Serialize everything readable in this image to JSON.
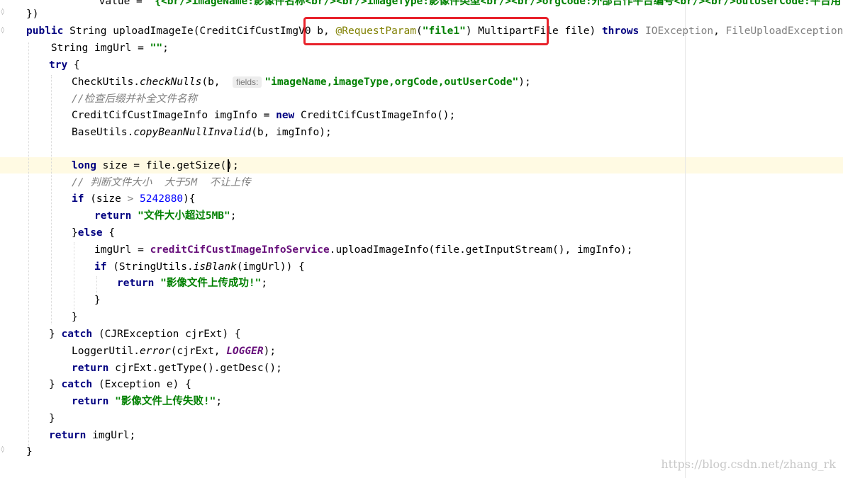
{
  "editor": {
    "top_line": {
      "prefix": "                value = ",
      "text": "\"{<br/>imageName:影像件名称<br/><br/>imageType:影像件类型<br/><br/>orgCode:外部合作平台编号<br/><br/>outUserCode:平台用"
    },
    "lines": {
      "l01": "})",
      "l02_kw1": "public",
      "l02_a": " String uploadImageIe(CreditCifCustImgV0 b, ",
      "l02_ann": "@RequestParam",
      "l02_b": "(",
      "l02_str": "\"file1\"",
      "l02_c": ") MultipartFile file) ",
      "l02_kw2": "throws",
      "l02_ex1": " IOException",
      "l02_d": ", ",
      "l02_ex2": "FileUploadException",
      "l02_e": " {",
      "l03_a": "    String imgUrl = ",
      "l03_str": "\"\"",
      "l03_b": ";",
      "l04_kw": "try",
      "l04_b": " {",
      "l05_a": "CheckUtils.",
      "l05_m": "checkNulls",
      "l05_b": "(b,  ",
      "l05_hint": "fields:",
      "l05_str": "\"imageName,imageType,orgCode,outUserCode\"",
      "l05_c": ");",
      "l06_cmt": "//检查后缀并补全文件名称",
      "l07_a": "CreditCifCustImageInfo imgInfo = ",
      "l07_kw": "new",
      "l07_b": " CreditCifCustImageInfo();",
      "l08_a": "BaseUtils.",
      "l08_m": "copyBeanNullInvalid",
      "l08_b": "(b, imgInfo);",
      "l10_kw": "long",
      "l10_a": " size = file.getSize();",
      "l11_cmt": "// 判断文件大小  大于5M  不让上传",
      "l12_kw": "if",
      "l12_a": " (size ",
      "l12_op": ">",
      "l12_sp": " ",
      "l12_num": "5242880",
      "l12_b": "){",
      "l13_kw": "return",
      "l13_str": " \"文件大小超过5MB\"",
      "l13_b": ";",
      "l14_a": "}",
      "l14_kw": "else",
      "l14_b": " {",
      "l15_a": "imgUrl = ",
      "l15_fld": "creditCifCustImageInfoService",
      "l15_b": ".uploadImageInfo(file.getInputStream(), imgInfo);",
      "l16_kw": "if",
      "l16_a": " (StringUtils.",
      "l16_m": "isBlank",
      "l16_b": "(imgUrl)) {",
      "l17_kw": "return",
      "l17_str": " \"影像文件上传成功!\"",
      "l17_b": ";",
      "l18": "}",
      "l19": "}",
      "l20_a": "} ",
      "l20_kw": "catch",
      "l20_b": " (CJRException cjrExt) {",
      "l21_a": "LoggerUtil.",
      "l21_m": "error",
      "l21_b": "(cjrExt, ",
      "l21_fld": "LOGGER",
      "l21_c": ");",
      "l22_kw": "return",
      "l22_a": " cjrExt.getType().getDesc();",
      "l23_a": "} ",
      "l23_kw": "catch",
      "l23_b": " (Exception e) {",
      "l24_kw": "return",
      "l24_str": " \"影像文件上传失败!\"",
      "l24_b": ";",
      "l25": "}",
      "l26_kw": "return",
      "l26_a": " imgUrl;",
      "l27": "}"
    }
  },
  "watermark": "https://blog.csdn.net/zhang_rk",
  "colors": {
    "keyword": "#000080",
    "string": "#008000",
    "annotation": "#808000",
    "number": "#0000ff",
    "field": "#660e7a",
    "comment": "#808080",
    "highlight_box": "#e8222b",
    "caret_line": "#fffae3"
  },
  "icons": [
    "fold-marker-icon"
  ]
}
